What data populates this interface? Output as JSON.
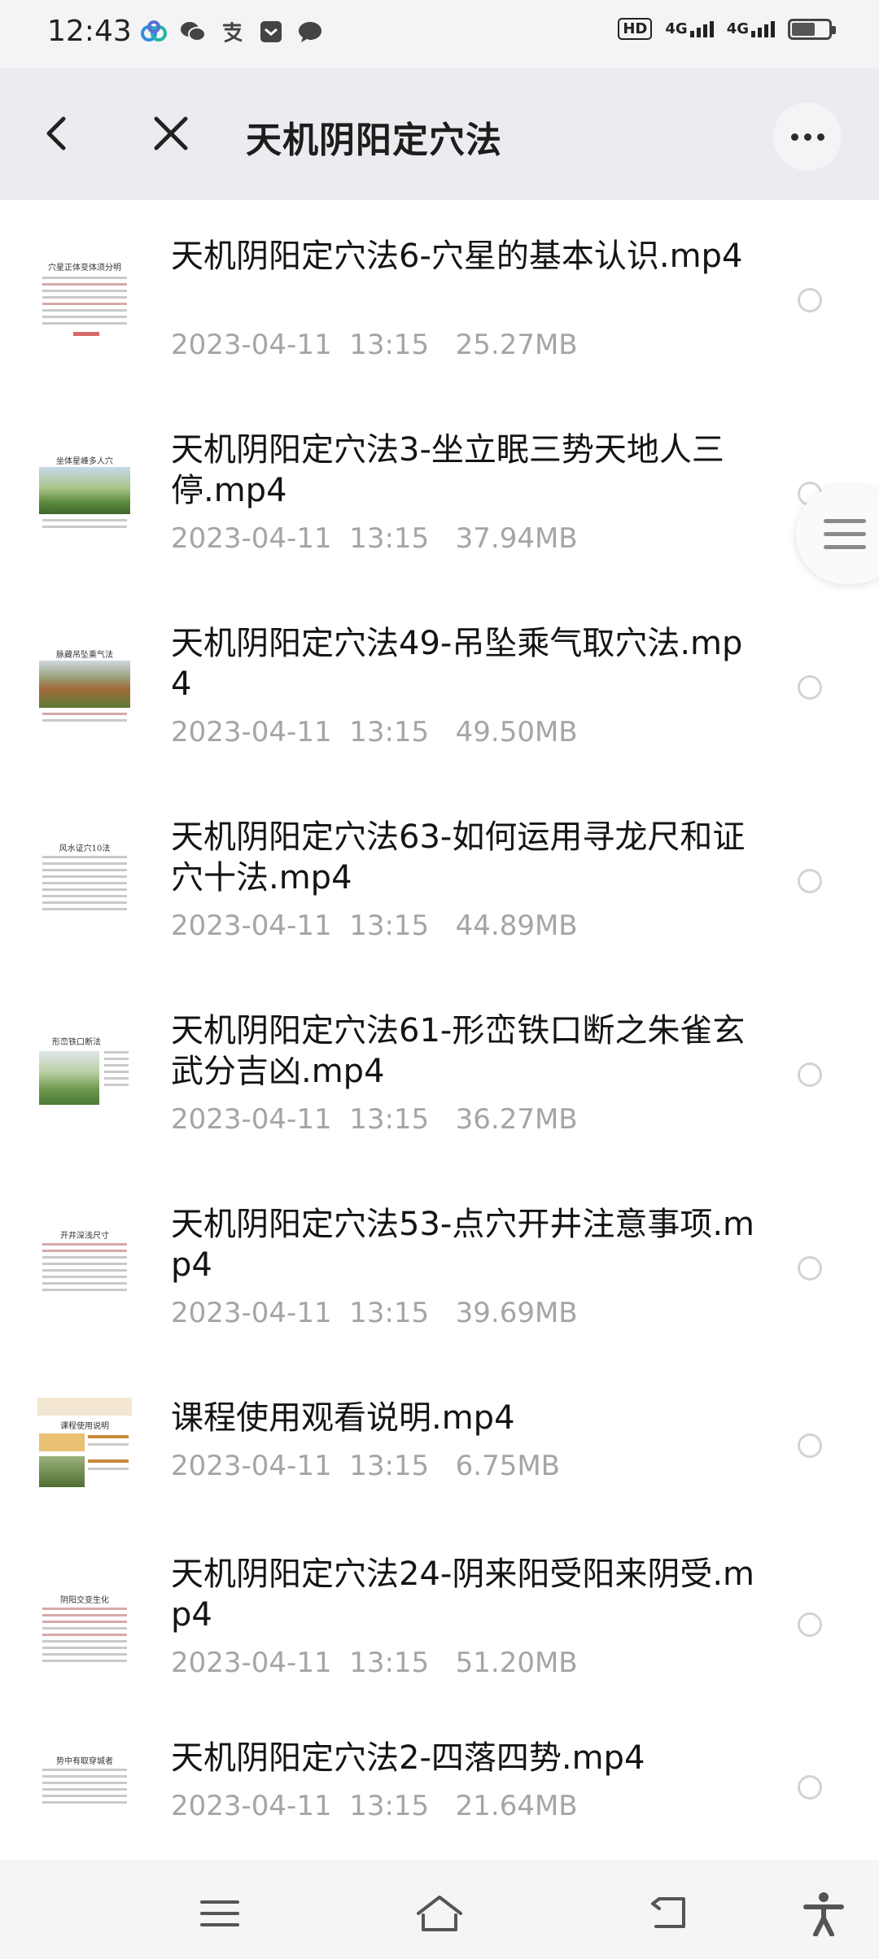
{
  "status_bar": {
    "time": "12:43",
    "hd_label": "HD",
    "sim1": "4G",
    "sim2": "4G",
    "notification_icons": [
      "baidu-netdisk-icon",
      "wechat-icon",
      "alipay-icon",
      "message-box-icon",
      "chat-bubble-icon"
    ]
  },
  "header": {
    "title": "天机阴阳定穴法"
  },
  "files": [
    {
      "name": "天机阴阳定穴法6-穴星的基本认识.mp4",
      "date": "2023-04-11  13:15",
      "size": "25.27MB",
      "thumb_caption": "穴星正体变体须分明"
    },
    {
      "name": "天机阴阳定穴法3-坐立眠三势天地人三停.mp4",
      "date": "2023-04-11  13:15",
      "size": "37.94MB",
      "thumb_caption": "坐体星峰多人穴"
    },
    {
      "name": "天机阴阳定穴法49-吊坠乘气取穴法.mp4",
      "date": "2023-04-11  13:15",
      "size": "49.50MB",
      "thumb_caption": "脉藏吊坠乘气法"
    },
    {
      "name": "天机阴阳定穴法63-如何运用寻龙尺和证穴十法.mp4",
      "date": "2023-04-11  13:15",
      "size": "44.89MB",
      "thumb_caption": "风水证穴10法"
    },
    {
      "name": "天机阴阳定穴法61-形峦铁口断之朱雀玄武分吉凶.mp4",
      "date": "2023-04-11  13:15",
      "size": "36.27MB",
      "thumb_caption": "形峦铁口断法"
    },
    {
      "name": "天机阴阳定穴法53-点穴开井注意事项.mp4",
      "date": "2023-04-11  13:15",
      "size": "39.69MB",
      "thumb_caption": "开井深浅尺寸"
    },
    {
      "name": "课程使用观看说明.mp4",
      "date": "2023-04-11  13:15",
      "size": "6.75MB",
      "thumb_caption": "课程使用说明"
    },
    {
      "name": "天机阴阳定穴法24-阴来阳受阳来阴受.mp4",
      "date": "2023-04-11  13:15",
      "size": "51.20MB",
      "thumb_caption": "阴阳交变生化"
    },
    {
      "name": "天机阴阳定穴法2-四落四势.mp4",
      "date": "2023-04-11  13:15",
      "size": "21.64MB",
      "thumb_caption": "势中有取穿城者"
    }
  ],
  "bottom_nav": [
    "menu-icon",
    "home-icon",
    "back-icon",
    "accessibility-icon"
  ]
}
